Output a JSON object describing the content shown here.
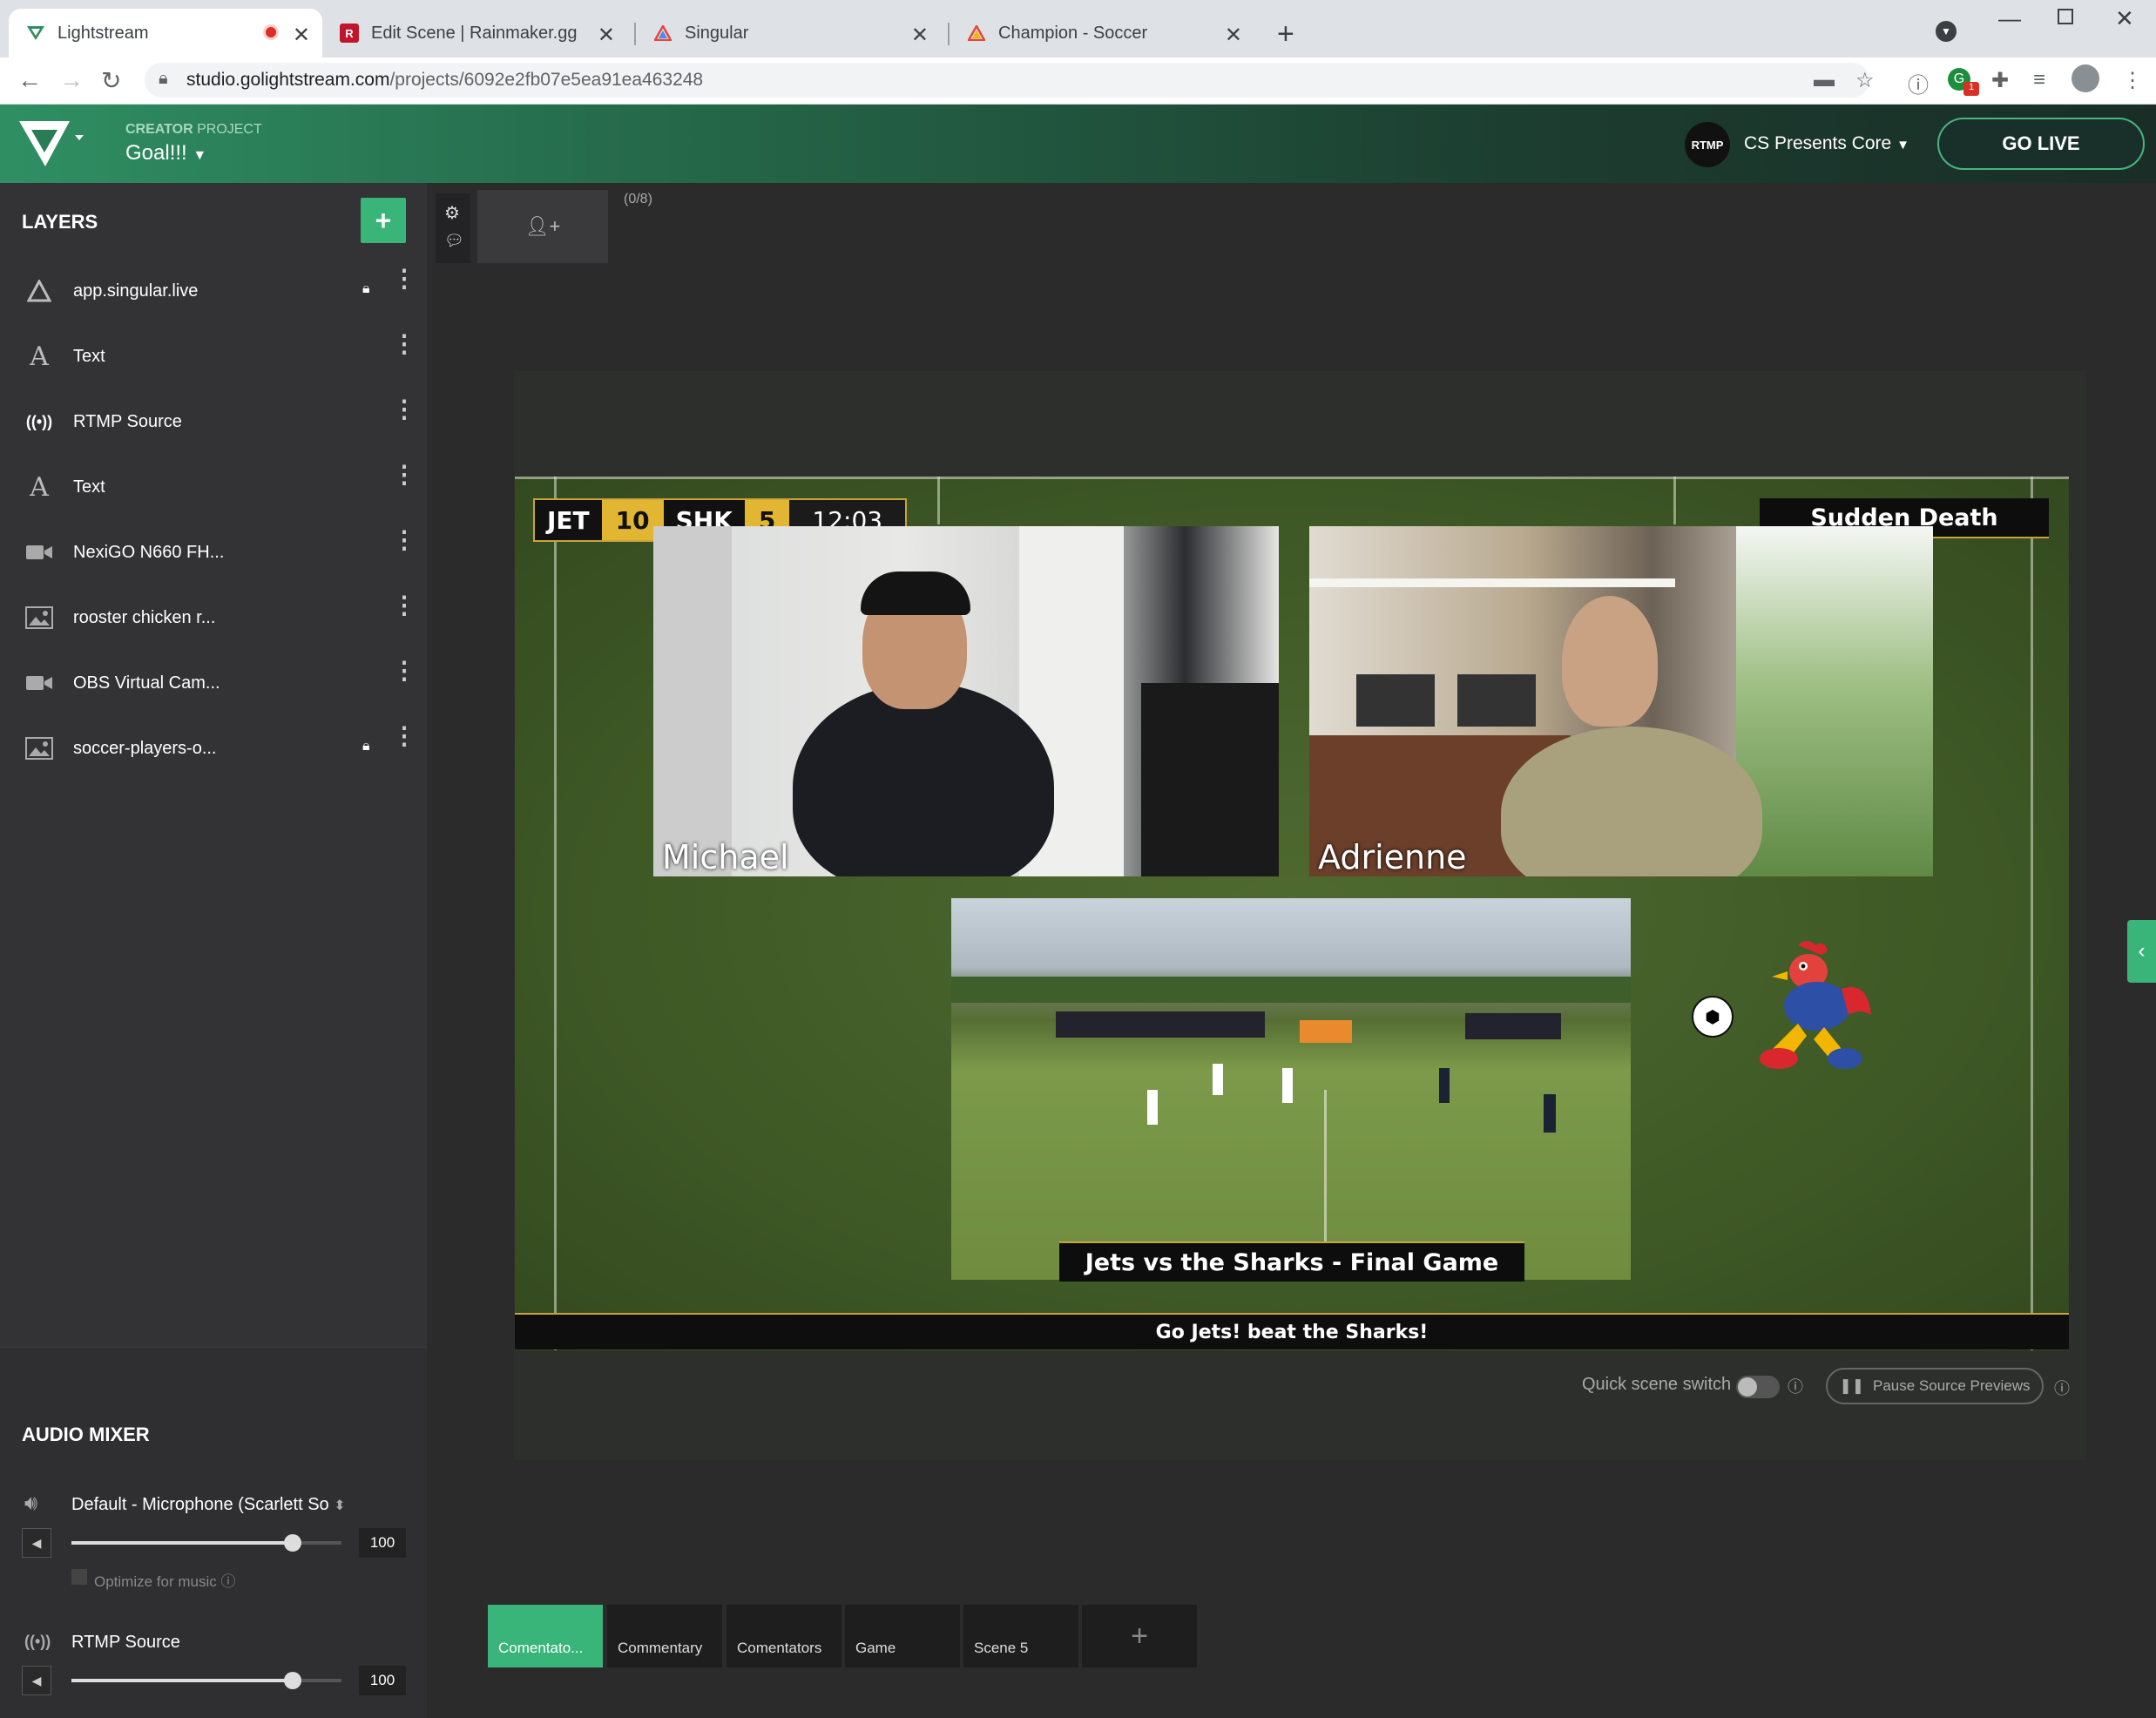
{
  "browser": {
    "tabs": [
      {
        "title": "Lightstream"
      },
      {
        "title": "Edit Scene | Rainmaker.gg"
      },
      {
        "title": "Singular"
      },
      {
        "title": "Champion - Soccer"
      }
    ],
    "url_host": "studio.golightstream.com",
    "url_path": "/projects/6092e2fb07e5ea91ea463248",
    "extension_badge": "1"
  },
  "header": {
    "project_type_strong": "CREATOR",
    "project_type_rest": " PROJECT",
    "project_name": "Goal!!!",
    "destination_badge": "RTMP",
    "destination_name": "CS Presents Core",
    "go_live_label": "GO LIVE"
  },
  "layers": {
    "title": "LAYERS",
    "add_label": "+",
    "items": [
      {
        "label": "app.singular.live",
        "icon": "singular-icon",
        "locked": true
      },
      {
        "label": "Text",
        "icon": "text-icon",
        "locked": false
      },
      {
        "label": "RTMP Source",
        "icon": "broadcast-icon",
        "locked": false
      },
      {
        "label": "Text",
        "icon": "text-icon",
        "locked": false
      },
      {
        "label": "NexiGO N660 FH...",
        "icon": "camera-icon",
        "locked": false
      },
      {
        "label": "rooster chicken r...",
        "icon": "image-icon",
        "locked": false
      },
      {
        "label": "OBS Virtual Cam...",
        "icon": "camera-icon",
        "locked": false
      },
      {
        "label": "soccer-players-o...",
        "icon": "image-icon",
        "locked": true
      }
    ]
  },
  "audio_mixer": {
    "title": "AUDIO MIXER",
    "channels": [
      {
        "name": "Default - Microphone (Scarlett So",
        "volume": "100",
        "level": 1.0
      },
      {
        "name": "RTMP Source",
        "volume": "100",
        "level": 1.0
      }
    ],
    "optimize_label": "Optimize for music"
  },
  "guests": {
    "count": "(0/8)"
  },
  "stage": {
    "scorebug": {
      "team1": "JET",
      "score1": "10",
      "team2": "SHK",
      "score2": "5",
      "clock": "12:03"
    },
    "banner": "Sudden Death",
    "cam1_name": "Michael",
    "cam2_name": "Adrienne",
    "game_title": "Jets vs the Sharks - Final Game",
    "ticker": "Go Jets! beat the Sharks!"
  },
  "controls": {
    "quick_switch_label": "Quick scene switch",
    "quick_switch_on": false,
    "pause_label": "Pause Source Previews"
  },
  "scenes": [
    {
      "label": "Comentato...",
      "active": true
    },
    {
      "label": "Commentary",
      "active": false
    },
    {
      "label": "Comentators",
      "active": false
    },
    {
      "label": "Game",
      "active": false
    },
    {
      "label": "Scene 5",
      "active": false
    }
  ],
  "colors": {
    "accent": "#3ab57a",
    "scorebug_gold": "#e2b533"
  }
}
